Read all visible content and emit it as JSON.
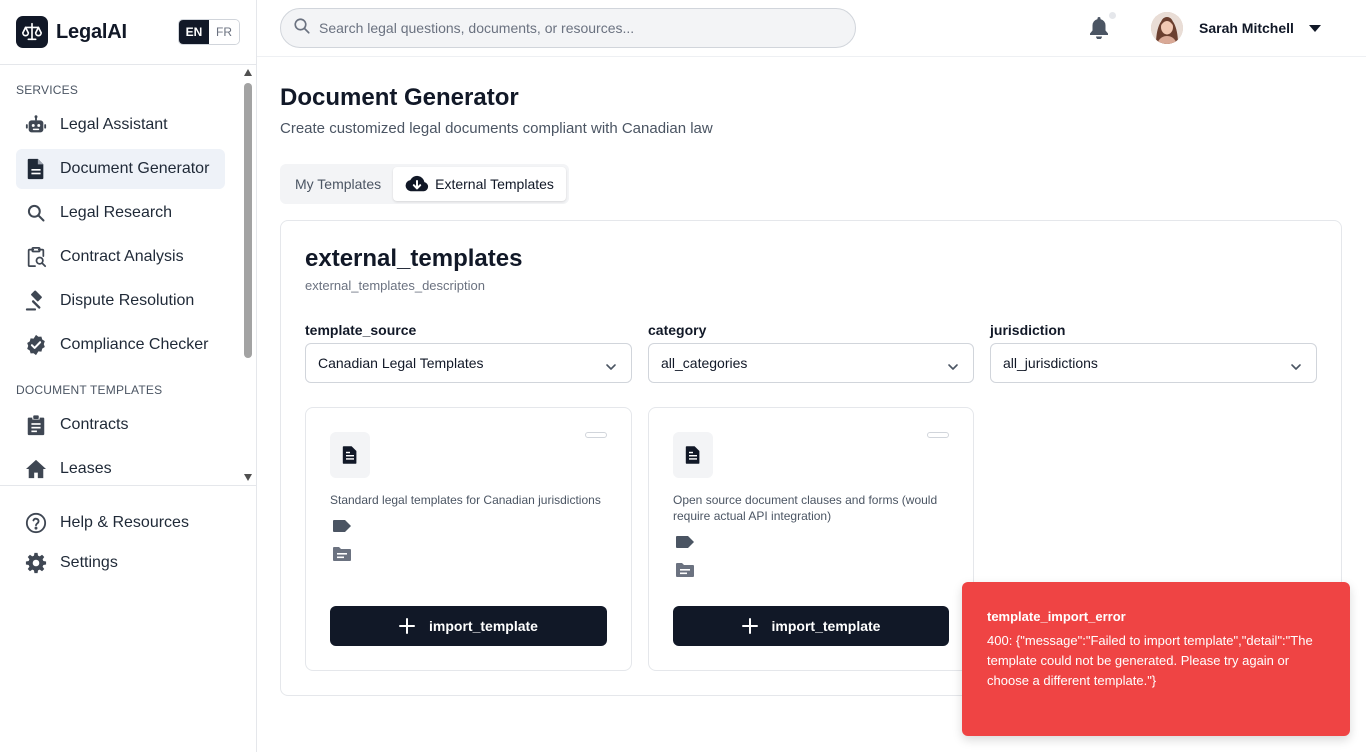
{
  "brand": {
    "name": "LegalAI"
  },
  "language": {
    "options": [
      "EN",
      "FR"
    ],
    "selected": "EN"
  },
  "sidebar": {
    "sections": [
      {
        "label": "SERVICES"
      },
      {
        "label": "DOCUMENT TEMPLATES"
      }
    ],
    "services": [
      {
        "label": "Legal Assistant",
        "icon": "robot-icon"
      },
      {
        "label": "Document Generator",
        "icon": "file-text-icon",
        "active": true
      },
      {
        "label": "Legal Research",
        "icon": "search-icon"
      },
      {
        "label": "Contract Analysis",
        "icon": "clipboard-search-icon"
      },
      {
        "label": "Dispute Resolution",
        "icon": "gavel-icon"
      },
      {
        "label": "Compliance Checker",
        "icon": "badge-check-icon"
      }
    ],
    "templates": [
      {
        "label": "Contracts",
        "icon": "clipboard-list-icon"
      },
      {
        "label": "Leases",
        "icon": "home-icon"
      }
    ],
    "footer": [
      {
        "label": "Help & Resources",
        "icon": "help-circle-icon"
      },
      {
        "label": "Settings",
        "icon": "gear-icon"
      }
    ]
  },
  "header": {
    "search_placeholder": "Search legal questions, documents, or resources...",
    "user_name": "Sarah Mitchell"
  },
  "main": {
    "title": "Document Generator",
    "subtitle": "Create customized legal documents compliant with Canadian law",
    "tabs": [
      {
        "label": "My Templates",
        "active": false
      },
      {
        "label": "External Templates",
        "active": true
      }
    ]
  },
  "panel": {
    "title": "external_templates",
    "description": "external_templates_description",
    "filters": [
      {
        "label": "template_source",
        "value": "Canadian Legal Templates"
      },
      {
        "label": "category",
        "value": "all_categories"
      },
      {
        "label": "jurisdiction",
        "value": "all_jurisdictions"
      }
    ],
    "cards": [
      {
        "description": "Standard legal templates for Canadian jurisdictions",
        "button": "import_template"
      },
      {
        "description": "Open source document clauses and forms (would require actual API integration)",
        "button": "import_template"
      }
    ]
  },
  "toast": {
    "title": "template_import_error",
    "message": "400: {\"message\":\"Failed to import template\",\"detail\":\"The template could not be generated. Please try again or choose a different template.\"}",
    "color": "#ef4444"
  }
}
